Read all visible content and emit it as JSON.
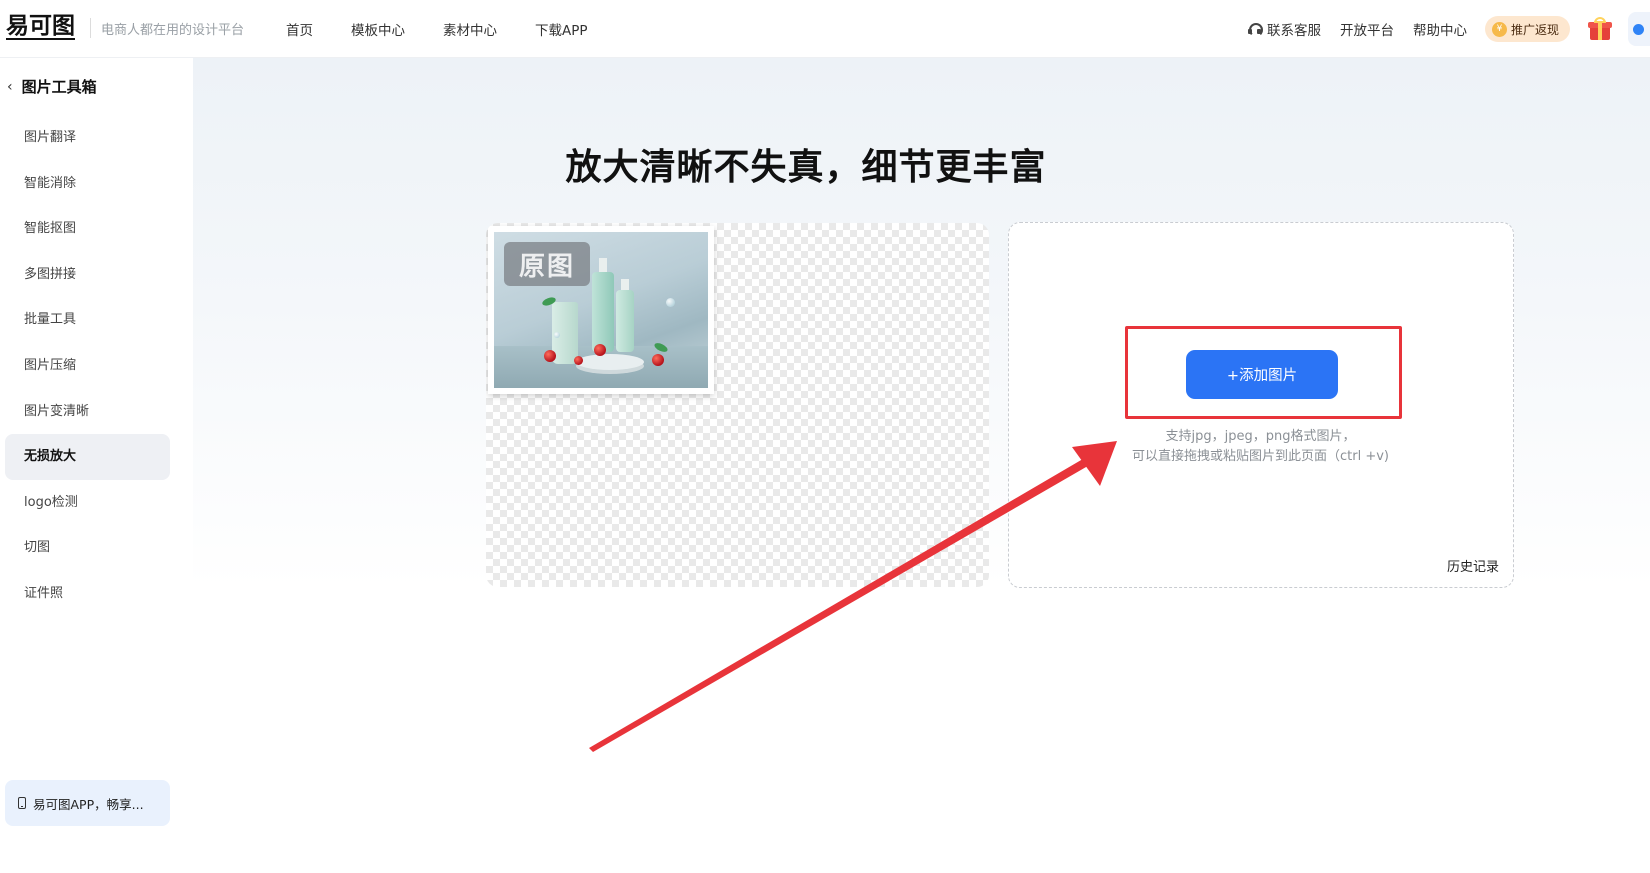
{
  "header": {
    "logo": "易可图",
    "slogan": "电商人都在用的设计平台",
    "nav": [
      "首页",
      "模板中心",
      "素材中心",
      "下载APP"
    ],
    "right_links": {
      "support": "联系客服",
      "open_platform": "开放平台",
      "help_center": "帮助中心"
    },
    "promo_label": "推广返现"
  },
  "sidebar": {
    "title": "图片工具箱",
    "items": [
      {
        "label": "图片翻译"
      },
      {
        "label": "智能消除"
      },
      {
        "label": "智能抠图"
      },
      {
        "label": "多图拼接"
      },
      {
        "label": "批量工具"
      },
      {
        "label": "图片压缩"
      },
      {
        "label": "图片变清晰"
      },
      {
        "label": "无损放大",
        "active": true
      },
      {
        "label": "logo检测"
      },
      {
        "label": "切图"
      },
      {
        "label": "证件照"
      }
    ],
    "app_banner": "易可图APP，畅享..."
  },
  "main": {
    "headline": "放大清晰不失真，细节更丰富",
    "preview": {
      "watermark": "原图"
    },
    "upload": {
      "button_label": "+添加图片",
      "hint_line1": "支持jpg，jpeg，png格式图片，",
      "hint_line2": "可以直接拖拽或粘贴图片到此页面（ctrl +v)",
      "history_label": "历史记录"
    }
  },
  "colors": {
    "primary": "#2b74f5",
    "annotation_red": "#e8343a",
    "active_item_bg": "#eef0f4",
    "promo_bg": "#fde7cf"
  },
  "icons": [
    "back-chevron-icon",
    "headset-icon",
    "coin-icon",
    "gift-icon",
    "phone-icon"
  ]
}
